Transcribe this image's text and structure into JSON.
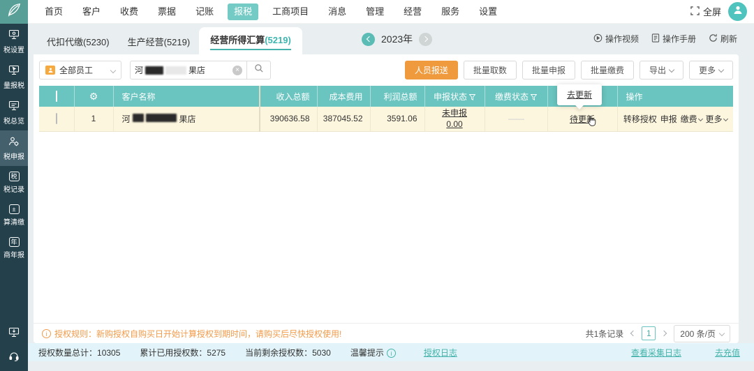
{
  "colors": {
    "accent": "#6ac4bf",
    "sidebar_bg": "#24404b",
    "primary_orange": "#f09a3e",
    "row_bg": "#fdf6de",
    "footer_bg": "#e2f4f9"
  },
  "topnav": {
    "items": [
      "首页",
      "客户",
      "收费",
      "票据",
      "记账",
      "报税",
      "工商项目",
      "消息",
      "管理",
      "经营",
      "服务",
      "设置"
    ],
    "active_item": "报税",
    "fullscreen_label": "全屏"
  },
  "sidebar": {
    "items": [
      {
        "label": "税设置"
      },
      {
        "label": "量报税"
      },
      {
        "label": "税总览"
      },
      {
        "label": "税申报"
      },
      {
        "label": "税记录"
      },
      {
        "label": "算清缴"
      },
      {
        "label": "商年报"
      }
    ],
    "active_label": "税申报",
    "icon_glyphs": {
      "tax": "税",
      "calc": "±",
      "year": "年"
    }
  },
  "tabs": {
    "items": [
      {
        "label": "代扣代缴",
        "count": "(5230)"
      },
      {
        "label": "生产经营",
        "count": "(5219)"
      },
      {
        "label": "经营所得汇算",
        "count": "(5219)"
      }
    ],
    "active_label": "经营所得汇算"
  },
  "year_nav": {
    "value": "2023年"
  },
  "page_actions": {
    "video": "操作视频",
    "manual": "操作手册",
    "refresh": "刷新"
  },
  "toolbar": {
    "employee_filter": "全部员工",
    "search": {
      "prefix": "河",
      "suffix": "果店",
      "clear": "×"
    },
    "buttons": {
      "send": "人员报送",
      "batch_fetch": "批量取数",
      "batch_declare": "批量申报",
      "batch_pay": "批量缴费",
      "export": "导出",
      "more": "更多"
    }
  },
  "table": {
    "headers": {
      "customer": "客户名称",
      "income": "收入总额",
      "cost": "成本费用",
      "profit": "利润总额",
      "declare_status": "申报状态",
      "pay_status": "缴费状态",
      "operation": "操作"
    },
    "tooltip": "去更新",
    "row": {
      "index": "1",
      "customer_prefix": "河",
      "customer_suffix": "果店",
      "income": "390636.58",
      "cost": "387045.52",
      "profit": "3591.06",
      "declare_status": "未申报",
      "declare_amount": "0.00",
      "pay_status": "——",
      "update_status": "待更新",
      "ops": {
        "transfer": "转移授权",
        "declare": "申报",
        "pay": "缴费",
        "more": "更多"
      }
    }
  },
  "notice": "授权规则：新购授权自购买日开始计算授权到期时间，请购买后尽快授权使用!",
  "pagination": {
    "total": "共1条记录",
    "page": "1",
    "page_size": "200 条/页"
  },
  "footer": {
    "total_label": "授权数量总计：",
    "total_value": "10305",
    "used_label": "累计已用授权数：",
    "used_value": "5275",
    "remain_label": "当前剩余授权数：",
    "remain_value": "5030",
    "tip": "温馨提示",
    "auth_log": "授权日志",
    "collect_log": "查看采集日志",
    "recharge": "去充值"
  }
}
